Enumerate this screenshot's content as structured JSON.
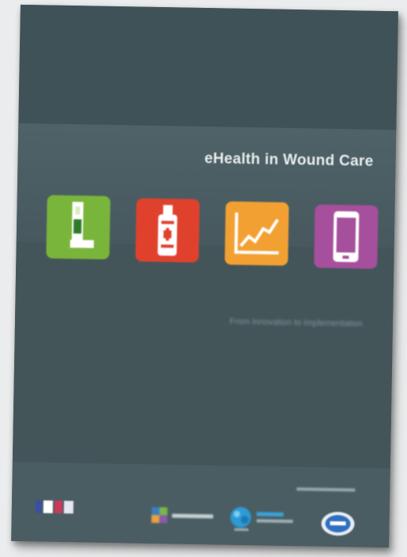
{
  "cover": {
    "title": "eHealth in Wound Care",
    "subtitle": "From innovation to implementation"
  },
  "icons": [
    {
      "name": "leg-bandage-icon",
      "color": "#79b53a"
    },
    {
      "name": "usb-stick-icon",
      "color": "#e0412d"
    },
    {
      "name": "line-chart-icon",
      "color": "#f3a033"
    },
    {
      "name": "smartphone-icon",
      "color": "#a64f9c"
    }
  ],
  "colors": {
    "cover_background": "#44585f",
    "title_text": "#e8ecec"
  }
}
